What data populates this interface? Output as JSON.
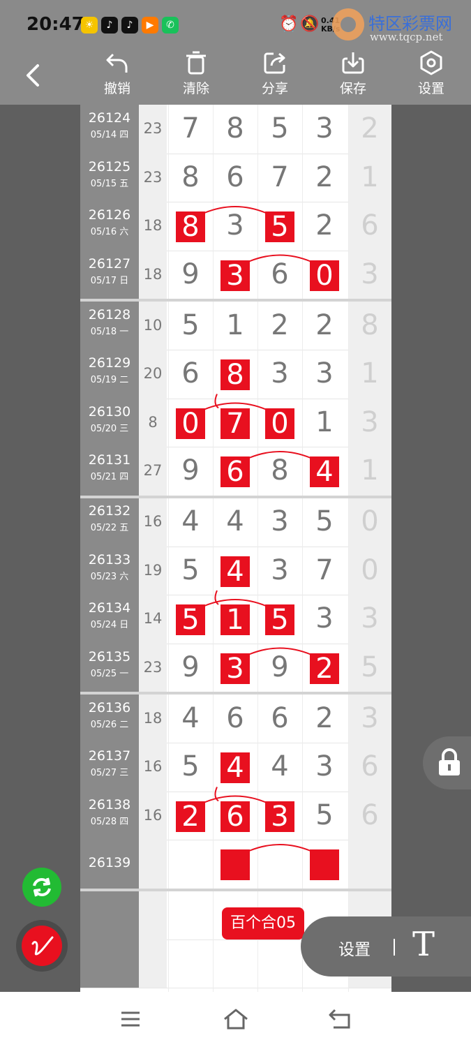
{
  "status": {
    "time": "20:47",
    "speed_value": "0.41",
    "speed_unit": "KB/s",
    "apps": [
      {
        "icon": "sun-app-icon",
        "color": "#f5c400",
        "glyph": "☀"
      },
      {
        "icon": "tiktok-icon",
        "color": "#111111",
        "glyph": "♪"
      },
      {
        "icon": "tiktok-icon",
        "color": "#111111",
        "glyph": "♪"
      },
      {
        "icon": "video-app-icon",
        "color": "#ff7a00",
        "glyph": "▶"
      },
      {
        "icon": "phone-app-icon",
        "color": "#19c15a",
        "glyph": "✆"
      }
    ]
  },
  "watermark": {
    "title": "特区彩票网",
    "url": "www.tqcp.net"
  },
  "toolbar": {
    "undo": "撤销",
    "clear": "清除",
    "share": "分享",
    "save": "保存",
    "settings": "设置"
  },
  "colors": {
    "accent": "#e8101f",
    "gray": "#8a8a8a",
    "dark": "#5f5f5f",
    "digit": "#777777",
    "last": "#cfcfcf",
    "green": "#22bb33"
  },
  "rows": [
    {
      "issue": "26124",
      "date": "05/14 四",
      "sum": "23",
      "digits": [
        "7",
        "8",
        "5",
        "3"
      ],
      "hl": [],
      "last": "2"
    },
    {
      "issue": "26125",
      "date": "05/15 五",
      "sum": "23",
      "digits": [
        "8",
        "6",
        "7",
        "2"
      ],
      "hl": [],
      "last": "1"
    },
    {
      "issue": "26126",
      "date": "05/16 六",
      "sum": "18",
      "digits": [
        "8",
        "3",
        "5",
        "2"
      ],
      "hl": [
        0,
        2
      ],
      "last": "6"
    },
    {
      "issue": "26127",
      "date": "05/17 日",
      "sum": "18",
      "digits": [
        "9",
        "3",
        "6",
        "0"
      ],
      "hl": [
        1,
        3
      ],
      "last": "3"
    },
    {
      "issue": "26128",
      "date": "05/18 一",
      "sum": "10",
      "digits": [
        "5",
        "1",
        "2",
        "2"
      ],
      "hl": [],
      "last": "8"
    },
    {
      "issue": "26129",
      "date": "05/19 二",
      "sum": "20",
      "digits": [
        "6",
        "8",
        "3",
        "3"
      ],
      "hl": [
        1
      ],
      "last": "1"
    },
    {
      "issue": "26130",
      "date": "05/20 三",
      "sum": "8",
      "digits": [
        "0",
        "7",
        "0",
        "1"
      ],
      "hl": [
        0,
        1,
        2
      ],
      "last": "3"
    },
    {
      "issue": "26131",
      "date": "05/21 四",
      "sum": "27",
      "digits": [
        "9",
        "6",
        "8",
        "4"
      ],
      "hl": [
        1,
        3
      ],
      "last": "1"
    },
    {
      "issue": "26132",
      "date": "05/22 五",
      "sum": "16",
      "digits": [
        "4",
        "4",
        "3",
        "5"
      ],
      "hl": [],
      "last": "0"
    },
    {
      "issue": "26133",
      "date": "05/23 六",
      "sum": "19",
      "digits": [
        "5",
        "4",
        "3",
        "7"
      ],
      "hl": [
        1
      ],
      "last": "0"
    },
    {
      "issue": "26134",
      "date": "05/24 日",
      "sum": "14",
      "digits": [
        "5",
        "1",
        "5",
        "3"
      ],
      "hl": [
        0,
        1,
        2
      ],
      "last": "3"
    },
    {
      "issue": "26135",
      "date": "05/25 一",
      "sum": "23",
      "digits": [
        "9",
        "3",
        "9",
        "2"
      ],
      "hl": [
        1,
        3
      ],
      "last": "5"
    },
    {
      "issue": "26136",
      "date": "05/26 二",
      "sum": "18",
      "digits": [
        "4",
        "6",
        "6",
        "2"
      ],
      "hl": [],
      "last": "3"
    },
    {
      "issue": "26137",
      "date": "05/27 三",
      "sum": "16",
      "digits": [
        "5",
        "4",
        "4",
        "3"
      ],
      "hl": [
        1
      ],
      "last": "6"
    },
    {
      "issue": "26138",
      "date": "05/28 四",
      "sum": "16",
      "digits": [
        "2",
        "6",
        "3",
        "5"
      ],
      "hl": [
        0,
        1,
        2
      ],
      "last": "6"
    },
    {
      "issue": "26139",
      "date": "",
      "sum": "",
      "digits": [
        "",
        "",
        "",
        ""
      ],
      "hl": [
        1,
        3
      ],
      "last": ""
    },
    {
      "issue": "",
      "date": "",
      "sum": "",
      "digits": [
        "",
        "",
        "",
        ""
      ],
      "hl": [],
      "last": ""
    },
    {
      "issue": "",
      "date": "",
      "sum": "",
      "digits": [
        "",
        "",
        "",
        ""
      ],
      "hl": [],
      "last": ""
    }
  ],
  "label_pill": "百个合05",
  "settings_panel": {
    "label": "设置",
    "text_tool": "T"
  },
  "icons": {
    "back": "back-arrow-icon",
    "refresh": "refresh-icon",
    "pen": "pen-icon",
    "lock": "lock-icon",
    "menu": "menu-icon",
    "home": "home-icon",
    "return": "return-icon"
  }
}
